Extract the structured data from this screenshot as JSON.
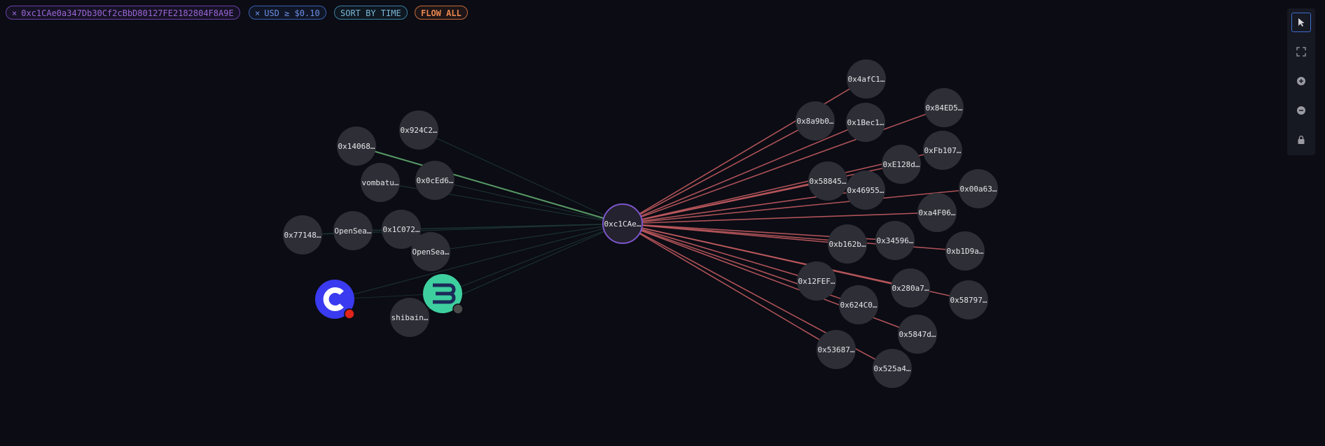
{
  "filters": {
    "address": {
      "remove": "×",
      "label": "0xc1CAe0a347Db30Cf2cBbD80127FE2182804F8A9E"
    },
    "usd": {
      "remove": "×",
      "label": "USD ≥ $0.10"
    },
    "sort_label": "SORT BY TIME",
    "flow_label": "FLOW ALL"
  },
  "colors": {
    "background": "#0b0c14",
    "node_fill": "#2e2f36",
    "center_stroke": "#7b55c9",
    "outflow_edge": "#c05a5e",
    "inflow_edge": "#5fa86d",
    "faint_edge": "#1f3a36"
  },
  "center_node": {
    "label": "0xc1CAe…"
  },
  "inflow_nodes": [
    {
      "label": "0x924C2…"
    },
    {
      "label": "0x14068…"
    },
    {
      "label": "vombatu…"
    },
    {
      "label": "0x0cEd6…"
    },
    {
      "label": "0x77148…"
    },
    {
      "label": "OpenSea…"
    },
    {
      "label": "0x1C072…"
    },
    {
      "label": "OpenSea…"
    },
    {
      "label": "shibain…"
    }
  ],
  "logo_nodes": [
    {
      "name": "c-logo",
      "icon": "coinbase-c-icon",
      "color": "#3a3af0",
      "badge": "#e0241b"
    },
    {
      "name": "b-logo",
      "icon": "b-logo-icon",
      "color": "#3ecf9e",
      "badge": "#4a4a4a"
    }
  ],
  "outflow_nodes": [
    {
      "label": "0x4afC1…"
    },
    {
      "label": "0x84ED5…"
    },
    {
      "label": "0x8a9b0…"
    },
    {
      "label": "0x1Bec1…"
    },
    {
      "label": "0xFb107…"
    },
    {
      "label": "0xE128d…"
    },
    {
      "label": "0x58845…"
    },
    {
      "label": "0x46955…"
    },
    {
      "label": "0x00a63…"
    },
    {
      "label": "0xa4F06…"
    },
    {
      "label": "0xb162b…"
    },
    {
      "label": "0x34596…"
    },
    {
      "label": "0xb1D9a…"
    },
    {
      "label": "0x12FEF…"
    },
    {
      "label": "0x280a7…"
    },
    {
      "label": "0x58797…"
    },
    {
      "label": "0x624C0…"
    },
    {
      "label": "0x5847d…"
    },
    {
      "label": "0x53687…"
    },
    {
      "label": "0x525a4…"
    }
  ],
  "toolbar": [
    {
      "name": "select-tool-button",
      "icon": "cursor-icon",
      "active": true
    },
    {
      "name": "fit-view-button",
      "icon": "expand-icon",
      "active": false
    },
    {
      "name": "zoom-in-button",
      "icon": "zoom-in-icon",
      "active": false
    },
    {
      "name": "zoom-out-button",
      "icon": "zoom-out-icon",
      "active": false
    },
    {
      "name": "lock-button",
      "icon": "lock-icon",
      "active": false
    }
  ]
}
